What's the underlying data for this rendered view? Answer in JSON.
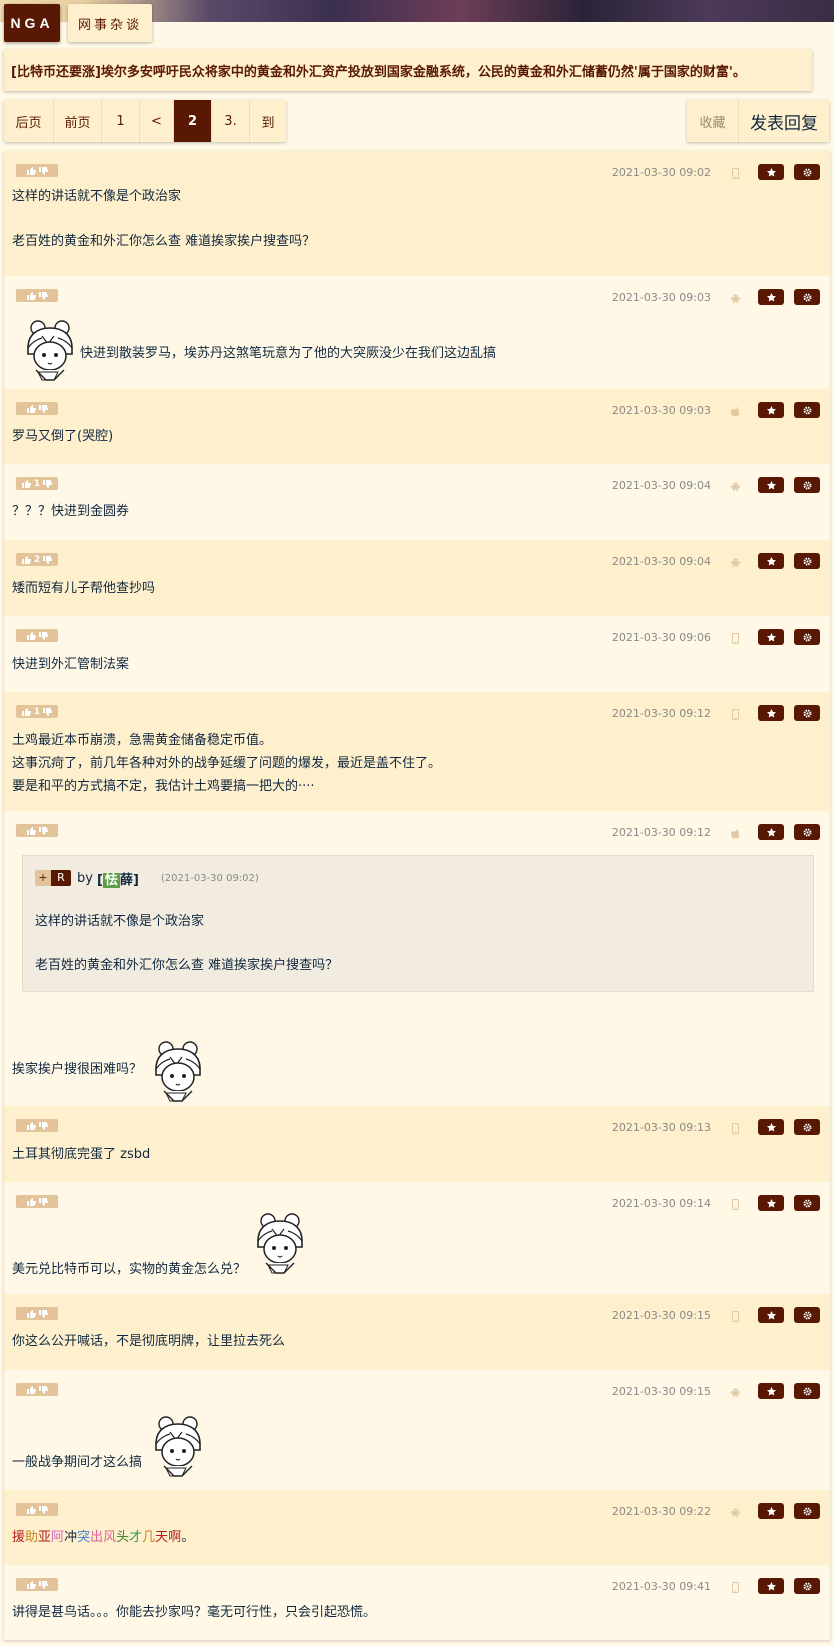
{
  "nav": {
    "logo": "NGA",
    "forum": "网事杂谈"
  },
  "thread": {
    "title": "[比特币还要涨]埃尔多安呼吁民众将家中的黄金和外汇资产投放到国家金融系统，公民的黄金和外汇储蓄仍然'属于国家的财富'。"
  },
  "pager": {
    "items": [
      {
        "label": "后页",
        "active": false
      },
      {
        "label": "前页",
        "active": false
      },
      {
        "label": "1",
        "active": false
      },
      {
        "label": "<",
        "active": false
      },
      {
        "label": "2",
        "active": true
      },
      {
        "label": "3.",
        "active": false
      },
      {
        "label": "到",
        "active": false
      }
    ]
  },
  "actions": {
    "favorite": "收藏",
    "reply": "发表回复"
  },
  "posts": [
    {
      "time": "2021-03-30 09:02",
      "votes": "",
      "device": "phone",
      "lines": [
        "这样的讲话就不像是个政治家",
        "",
        "老百姓的黄金和外汇你怎么查 难道挨家挨户搜查吗？"
      ]
    },
    {
      "time": "2021-03-30 09:03",
      "votes": "",
      "device": "android",
      "lines": [
        "快进到散装罗马，埃苏丹这煞笔玩意为了他的大突厥没少在我们这边乱搞"
      ]
    },
    {
      "time": "2021-03-30 09:03",
      "votes": "",
      "device": "apple",
      "lines": [
        "罗马又倒了(哭腔)"
      ]
    },
    {
      "time": "2021-03-30 09:04",
      "votes": "1",
      "device": "android",
      "lines": [
        "？？？快进到金圆券"
      ]
    },
    {
      "time": "2021-03-30 09:04",
      "votes": "2",
      "device": "android",
      "lines": [
        "矮而短有儿子帮他查抄吗"
      ]
    },
    {
      "time": "2021-03-30 09:06",
      "votes": "",
      "device": "phone",
      "lines": [
        "快进到外汇管制法案"
      ]
    },
    {
      "time": "2021-03-30 09:12",
      "votes": "1",
      "device": "phone",
      "lines": [
        "土鸡最近本币崩溃，急需黄金储备稳定币值。",
        "这事沉疴了，前几年各种对外的战争延缓了问题的爆发，最近是盖不住了。",
        "要是和平的方式搞不定，我估计土鸡要搞一把大的····"
      ]
    },
    {
      "time": "2021-03-30 09:12",
      "votes": "",
      "device": "apple",
      "lines": [
        "挨家挨户搜很困难吗？"
      ],
      "quote": {
        "plus": "+",
        "r": "R",
        "by": "by",
        "user_hl": "怯",
        "user_rest": "薛",
        "time": "(2021-03-30 09:02)",
        "lines": [
          "这样的讲话就不像是个政治家",
          "",
          "老百姓的黄金和外汇你怎么查 难道挨家挨户搜查吗？"
        ]
      }
    },
    {
      "time": "2021-03-30 09:13",
      "votes": "",
      "device": "phone",
      "lines": [
        "土耳其彻底完蛋了 zsbd"
      ]
    },
    {
      "time": "2021-03-30 09:14",
      "votes": "",
      "device": "phone",
      "lines": [
        "美元兑比特币可以，实物的黄金怎么兑？"
      ]
    },
    {
      "time": "2021-03-30 09:15",
      "votes": "",
      "device": "phone",
      "lines": [
        "你这么公开喊话，不是彻底明牌，让里拉去死么"
      ]
    },
    {
      "time": "2021-03-30 09:15",
      "votes": "",
      "device": "android",
      "lines": [
        "一般战争期间才这么搞"
      ]
    },
    {
      "time": "2021-03-30 09:22",
      "votes": "",
      "device": "android",
      "lines": [
        "援助亚阿冲突出风头才几天啊。"
      ],
      "colored": [
        {
          "t": "援",
          "c": "#b22222"
        },
        {
          "t": "助",
          "c": "#c8861e"
        },
        {
          "t": "亚",
          "c": "#b22222"
        },
        {
          "t": "阿",
          "c": "#d06bbf"
        },
        {
          "t": "冲",
          "c": "#10273f"
        },
        {
          "t": "突",
          "c": "#3f7fd0"
        },
        {
          "t": "出",
          "c": "#e0609a"
        },
        {
          "t": "风",
          "c": "#e0609a"
        },
        {
          "t": "头",
          "c": "#3a7a2a"
        },
        {
          "t": "才",
          "c": "#2a9a5a"
        },
        {
          "t": "几",
          "c": "#c8861e"
        },
        {
          "t": "天",
          "c": "#b22222"
        },
        {
          "t": "啊",
          "c": "#b22222"
        },
        {
          "t": "。",
          "c": "#10273f"
        }
      ]
    },
    {
      "time": "2021-03-30 09:41",
      "votes": "",
      "device": "phone",
      "lines": [
        "讲得是甚鸟话。。。你能去抄家吗？毫无可行性，只会引起恐慌。"
      ]
    }
  ]
}
